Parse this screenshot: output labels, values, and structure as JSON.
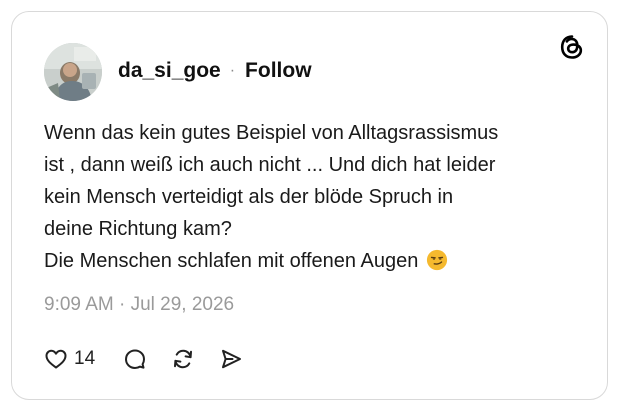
{
  "post": {
    "username": "da_si_goe",
    "separator": "·",
    "follow_label": "Follow",
    "body_lines": [
      "Wenn das kein gutes Beispiel von Alltagsrassismus",
      "ist , dann weiß ich auch nicht ... Und dich hat leider",
      "kein Mensch verteidigt als der blöde Spruch in",
      "deine Richtung kam?",
      "Die Menschen schlafen mit offenen Augen"
    ],
    "emoji": "smirking-face",
    "timestamp": "9:09 AM · Jul 29, 2026",
    "like_count": "14"
  },
  "icons": {
    "logo": "threads-logo-icon",
    "like": "heart-icon",
    "reply": "comment-icon",
    "repost": "repost-icon",
    "share": "send-icon"
  },
  "colors": {
    "text": "#1a1a1a",
    "muted": "#9a9a9a",
    "border": "#d9d9d9",
    "emoji": "#f5b92e"
  }
}
